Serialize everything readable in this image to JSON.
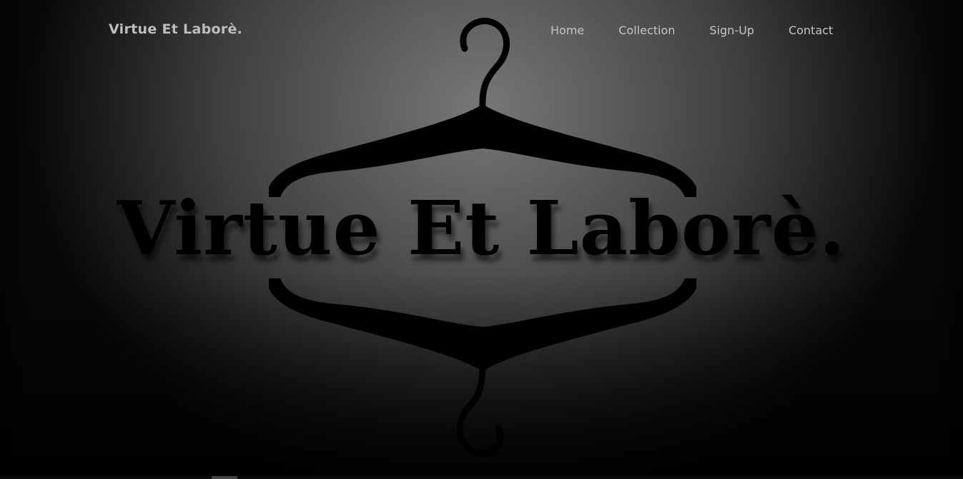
{
  "header": {
    "brand": "Virtue Et Laborè.",
    "nav": [
      {
        "label": "Home"
      },
      {
        "label": "Collection"
      },
      {
        "label": "Sign-Up"
      },
      {
        "label": "Contact"
      }
    ]
  },
  "hero": {
    "title": "Virtue Et Laborè.",
    "logo_icon": "clothes-hanger-icon"
  },
  "colors": {
    "background_center": "#777777",
    "background_edge": "#070707",
    "nav_text": "#c4c4c4",
    "logo": "#000000"
  }
}
